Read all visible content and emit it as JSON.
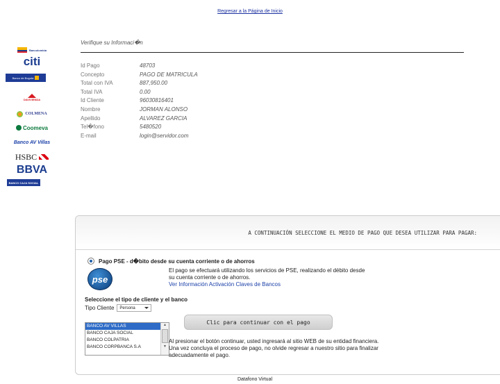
{
  "header": {
    "back_link": "Regresar a la Página de Inicio"
  },
  "logos": [
    {
      "name": "Bancolombia",
      "color": "#f5b400",
      "text_color": "#1f3a8a"
    },
    {
      "name": "citi",
      "color": "#ffffff",
      "text_color": "#1b3d8f"
    },
    {
      "name": "Banco de Bogotá",
      "color": "#1e3c96",
      "text_color": "#ffffff"
    },
    {
      "name": "DAVIVIENDA",
      "color": "#ffffff",
      "text_color": "#d71920"
    },
    {
      "name": "COLMENA",
      "color": "#ffffff",
      "text_color": "#2f3e8f"
    },
    {
      "name": "Coomeva",
      "color": "#ffffff",
      "text_color": "#0c7a3e"
    },
    {
      "name": "Banco AV Villas",
      "color": "#ffffff",
      "text_color": "#1a3fa8"
    },
    {
      "name": "HSBC",
      "color": "#ffffff",
      "text_color": "#222222"
    },
    {
      "name": "BBVA",
      "color": "#ffffff",
      "text_color": "#1b3d8f"
    },
    {
      "name": "BANCO CAJA SOCIAL",
      "color": "#1e3c96",
      "text_color": "#ffffff"
    }
  ],
  "info": {
    "title": "Verifique su Informaci�n",
    "rows": [
      {
        "label": "Id Pago",
        "value": "48703"
      },
      {
        "label": "Concepto",
        "value": "PAGO DE MATRICULA"
      },
      {
        "label": "Total con IVA",
        "value": "887,950.00"
      },
      {
        "label": "Total IVA",
        "value": "0.00"
      },
      {
        "label": "Id Cliente",
        "value": "96030816401"
      },
      {
        "label": "Nombre",
        "value": "JORMAN ALONSO"
      },
      {
        "label": "Apellido",
        "value": "ALVAREZ GARCIA"
      },
      {
        "label": "Tel�fono",
        "value": "5480520"
      },
      {
        "label": "E-mail",
        "value": "login@servidor.com"
      }
    ]
  },
  "payment": {
    "header": "A CONTINUACIÓN SELECCIONE EL MEDIO DE PAGO QUE DESEA UTILIZAR PARA PAGAR:",
    "pse_option": "Pago PSE - d�bito desde su cuenta corriente o de ahorros",
    "pse_logo": "pse",
    "pse_desc_1": "El pago se efectuará utilizando los servicios de PSE, realizando el débito desde",
    "pse_desc_2": "su cuenta corriente o de ahorros.",
    "pse_link": "Ver Información Activación Claves de Bancos",
    "select_title": "Seleccione el tipo de cliente y el banco",
    "tipo_label": "Tipo Cliente",
    "tipo_value": "Persona",
    "banks": [
      "BANCO AV VILLAS",
      "BANCO CAJA SOCIAL",
      "BANCO COLPATRIA",
      "BANCO CORPBANCA S.A"
    ],
    "selected_bank_index": 0,
    "continue_label": "Clic para continuar con el pago",
    "note_1": "Al presionar el botón continuar, usted ingresará al sitio WEB de su entidad financiera.",
    "note_2": "Una vez concluya el proceso de pago, no olvide regresar a nuestro sitio para finalizar",
    "note_3": "adecuadamente el pago."
  },
  "footer": {
    "datafono": "Datafono Virtual"
  }
}
